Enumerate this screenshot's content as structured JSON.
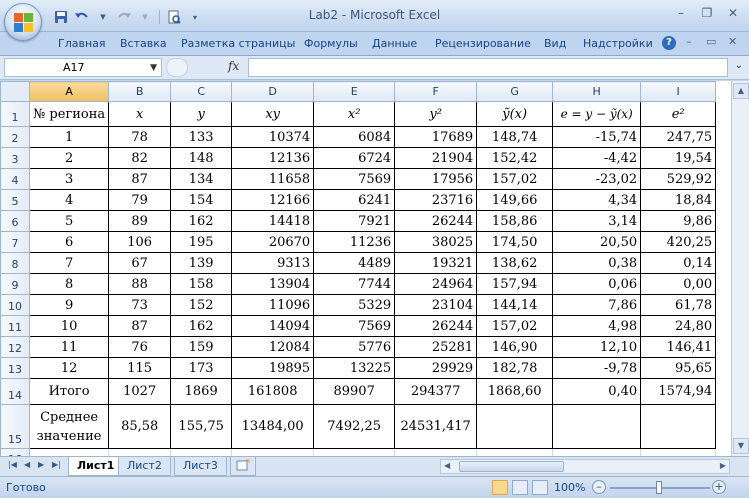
{
  "window": {
    "title": "Lab2 - Microsoft Excel"
  },
  "ribbon": {
    "tabs": [
      "Главная",
      "Вставка",
      "Разметка страницы",
      "Формулы",
      "Данные",
      "Рецензирование",
      "Вид",
      "Надстройки"
    ]
  },
  "formula_bar": {
    "name_box": "A17",
    "fx_label": "fx",
    "formula": ""
  },
  "columns": [
    "A",
    "B",
    "C",
    "D",
    "E",
    "F",
    "G",
    "H",
    "I"
  ],
  "selected_column": "A",
  "header_row": {
    "row": "1",
    "cells": [
      "№ региона",
      "x",
      "y",
      "xy",
      "x²",
      "y²",
      "ỹ(x)",
      "e = y − ỹ(x)",
      "e²"
    ]
  },
  "rows": [
    {
      "row": "2",
      "cells": [
        "1",
        "78",
        "133",
        "10374",
        "6084",
        "17689",
        "148,74",
        "-15,74",
        "247,75"
      ]
    },
    {
      "row": "3",
      "cells": [
        "2",
        "82",
        "148",
        "12136",
        "6724",
        "21904",
        "152,42",
        "-4,42",
        "19,54"
      ]
    },
    {
      "row": "4",
      "cells": [
        "3",
        "87",
        "134",
        "11658",
        "7569",
        "17956",
        "157,02",
        "-23,02",
        "529,92"
      ]
    },
    {
      "row": "5",
      "cells": [
        "4",
        "79",
        "154",
        "12166",
        "6241",
        "23716",
        "149,66",
        "4,34",
        "18,84"
      ]
    },
    {
      "row": "6",
      "cells": [
        "5",
        "89",
        "162",
        "14418",
        "7921",
        "26244",
        "158,86",
        "3,14",
        "9,86"
      ]
    },
    {
      "row": "7",
      "cells": [
        "6",
        "106",
        "195",
        "20670",
        "11236",
        "38025",
        "174,50",
        "20,50",
        "420,25"
      ]
    },
    {
      "row": "8",
      "cells": [
        "7",
        "67",
        "139",
        "9313",
        "4489",
        "19321",
        "138,62",
        "0,38",
        "0,14"
      ]
    },
    {
      "row": "9",
      "cells": [
        "8",
        "88",
        "158",
        "13904",
        "7744",
        "24964",
        "157,94",
        "0,06",
        "0,00"
      ]
    },
    {
      "row": "10",
      "cells": [
        "9",
        "73",
        "152",
        "11096",
        "5329",
        "23104",
        "144,14",
        "7,86",
        "61,78"
      ]
    },
    {
      "row": "11",
      "cells": [
        "10",
        "87",
        "162",
        "14094",
        "7569",
        "26244",
        "157,02",
        "4,98",
        "24,80"
      ]
    },
    {
      "row": "12",
      "cells": [
        "11",
        "76",
        "159",
        "12084",
        "5776",
        "25281",
        "146,90",
        "12,10",
        "146,41"
      ]
    },
    {
      "row": "13",
      "cells": [
        "12",
        "115",
        "173",
        "19895",
        "13225",
        "29929",
        "182,78",
        "-9,78",
        "95,65"
      ]
    }
  ],
  "total_row": {
    "row": "14",
    "cells": [
      "Итого",
      "1027",
      "1869",
      "161808",
      "89907",
      "294377",
      "1868,60",
      "0,40",
      "1574,94"
    ]
  },
  "mean_row": {
    "row": "15",
    "cells": [
      "Среднее значение",
      "85,58",
      "155,75",
      "13484,00",
      "7492,25",
      "24531,417",
      "",
      "",
      ""
    ]
  },
  "partial_row": "16",
  "sheet_tabs": [
    "Лист1",
    "Лист2",
    "Лист3"
  ],
  "active_sheet": "Лист1",
  "status": {
    "text": "Готово",
    "zoom": "100%",
    "zoom_percent": 100
  }
}
